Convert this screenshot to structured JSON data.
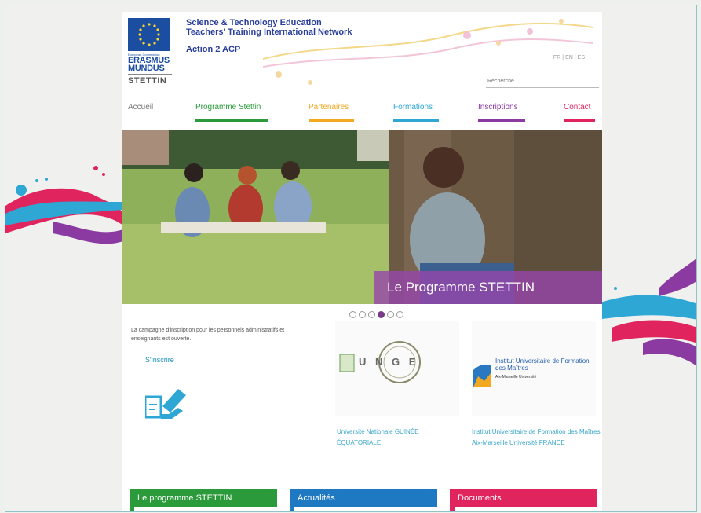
{
  "header": {
    "eu_small": "European Commission",
    "eu_erasmus_1": "ERASMUS",
    "eu_erasmus_2": "MUNDUS",
    "eu_stettin": "STETTIN",
    "title_line1": "Science & Technology Education",
    "title_line2": "Teachers' Training International Network",
    "subtitle": "Action 2 ACP"
  },
  "languages": [
    "FR",
    "EN",
    "ES"
  ],
  "search": {
    "placeholder": "Recherche"
  },
  "nav": [
    {
      "label": "Accueil",
      "color": "#777777"
    },
    {
      "label": "Programme Stettin",
      "color": "#2a9a3a"
    },
    {
      "label": "Partenaires",
      "color": "#f2a821"
    },
    {
      "label": "Formations",
      "color": "#2fa7d4"
    },
    {
      "label": "Inscriptions",
      "color": "#8a3aa0"
    },
    {
      "label": "Contact",
      "color": "#e0245e"
    }
  ],
  "hero": {
    "caption": "Le Programme STETTIN"
  },
  "slider": {
    "active_index": 3,
    "count": 6
  },
  "intro": {
    "text": "La campagne d'inscription pour les personnels administratifs et enseignants est ouverte.",
    "signup_link": "S'inscrire"
  },
  "partners": [
    {
      "logo_text": "U N G E",
      "name": "Université Nationale GUINÉE ÉQUATORIALE"
    },
    {
      "logo_text": "Institut Universitaire de Formation des Maîtres",
      "logo_sub": "Aix-Marseille Université",
      "name": "Institut Universitaire de Formation des Maîtres Aix-Marseille Université FRANCE"
    }
  ],
  "boxes": [
    {
      "label": "Le programme STETTIN",
      "color": "#2a9a3a"
    },
    {
      "label": "Actualités",
      "color": "#1e78c2"
    },
    {
      "label": "Documents",
      "color": "#e0245e"
    }
  ]
}
